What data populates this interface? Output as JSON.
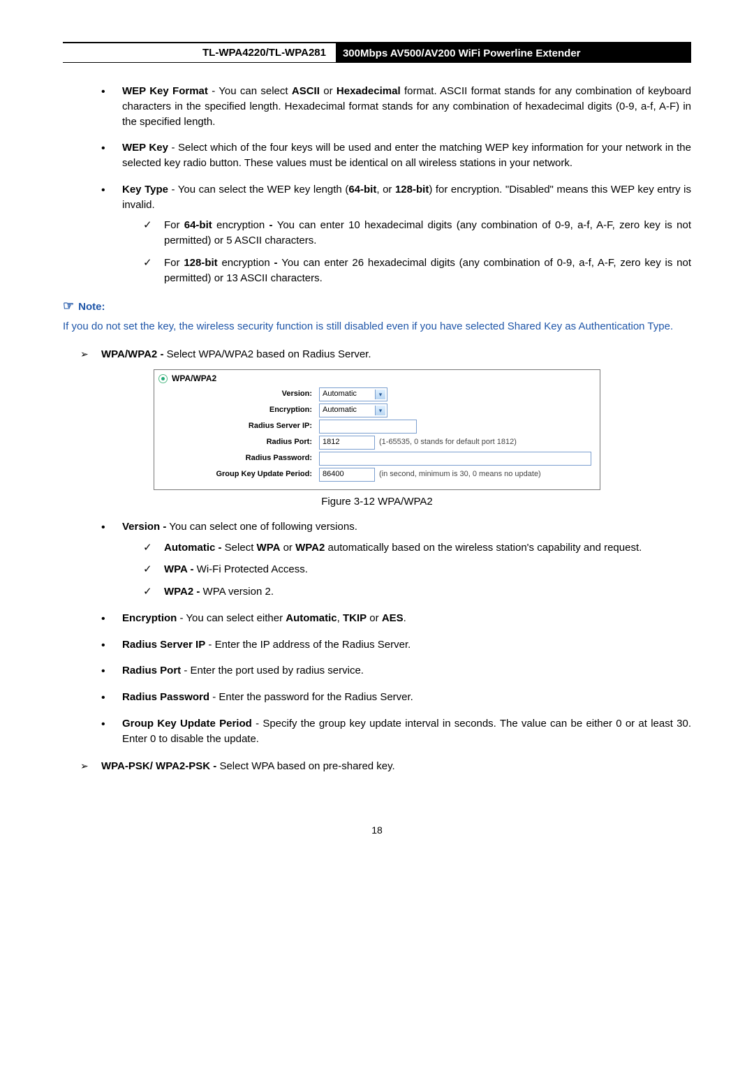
{
  "header": {
    "model": "TL-WPA4220/TL-WPA281",
    "product": "300Mbps AV500/AV200 WiFi Powerline Extender"
  },
  "wep": {
    "key_format_label": "WEP Key Format",
    "key_format_text": " - You can select ",
    "ascii": "ASCII",
    "or": " or ",
    "hex": "Hexadecimal",
    "key_format_tail": " format. ASCII format stands for any combination of keyboard characters in the specified length. Hexadecimal format stands for any combination of hexadecimal digits (0-9, a-f, A-F) in the specified length.",
    "wep_key_label": "WEP Key",
    "wep_key_text": " - Select which of the four keys will be used and enter the matching WEP key information for your network in the selected key radio button. These values must be identical on all wireless stations in your network.",
    "key_type_label": "Key Type",
    "key_type_text_a": " - You can select the WEP key length (",
    "bit64": "64-bit",
    "key_type_text_b": ", or ",
    "bit128": "128-bit",
    "key_type_text_c": ") for encryption. \"Disabled\" means this WEP key entry is invalid.",
    "for64_a": "For ",
    "for64_b": "64-bit",
    "for64_c": " encryption ",
    "for64_dash": "- ",
    "for64_text": "You can enter 10 hexadecimal digits (any combination of 0-9, a-f, A-F, zero key is not permitted) or 5 ASCII characters.",
    "for128_a": "For ",
    "for128_b": "128-bit",
    "for128_c": " encryption ",
    "for128_dash": "- ",
    "for128_text": "You can enter 26 hexadecimal digits (any combination of 0-9, a-f, A-F, zero key is not permitted) or 13 ASCII characters."
  },
  "note": {
    "label": "Note:",
    "body": "If you do not set the key, the wireless security function is still disabled even if you have selected Shared Key as Authentication Type."
  },
  "wpa_intro": {
    "label": "WPA/WPA2 -",
    "text": " Select WPA/WPA2 based on Radius Server."
  },
  "figure": {
    "title": "WPA/WPA2",
    "rows": {
      "version_label": "Version:",
      "version_value": "Automatic",
      "encryption_label": "Encryption:",
      "encryption_value": "Automatic",
      "radius_ip_label": "Radius Server IP:",
      "radius_ip_value": "",
      "radius_port_label": "Radius Port:",
      "radius_port_value": "1812",
      "radius_port_hint": "(1-65535, 0 stands for default port 1812)",
      "radius_pw_label": "Radius Password:",
      "radius_pw_value": "",
      "gkup_label": "Group Key Update Period:",
      "gkup_value": "86400",
      "gkup_hint": "(in second, minimum is 30, 0 means no update)"
    },
    "caption": "Figure 3-12 WPA/WPA2"
  },
  "wpa_list": {
    "version_label": "Version -",
    "version_text": " You can select one of following versions.",
    "auto_label": "Automatic -",
    "auto_text": " Select ",
    "auto_wpa": "WPA",
    "auto_or": " or ",
    "auto_wpa2": "WPA2",
    "auto_tail": " automatically based on the wireless station's capability and request.",
    "wpa_label": "WPA -",
    "wpa_text": " Wi-Fi Protected Access.",
    "wpa2_label": "WPA2 -",
    "wpa2_text": " WPA version 2.",
    "enc_label": "Encryption",
    "enc_text_a": " - You can select either ",
    "enc_auto": "Automatic",
    "enc_text_b": ", ",
    "enc_tkip": "TKIP",
    "enc_text_c": " or ",
    "enc_aes": "AES",
    "enc_text_d": ".",
    "rsip_label": "Radius Server IP",
    "rsip_text": " - Enter the IP address of the Radius Server.",
    "rport_label": "Radius Port",
    "rport_text": " - Enter the port used by radius service.",
    "rpw_label": "Radius Password",
    "rpw_text": " - Enter the password for the Radius Server.",
    "gkup_label": "Group Key Update Period",
    "gkup_text": " - Specify the group key update interval in seconds. The value can be either 0 or at least 30. Enter 0 to disable the update."
  },
  "psk": {
    "label": "WPA-PSK/ WPA2-PSK -",
    "text": " Select WPA based on pre-shared key."
  },
  "page_number": "18"
}
